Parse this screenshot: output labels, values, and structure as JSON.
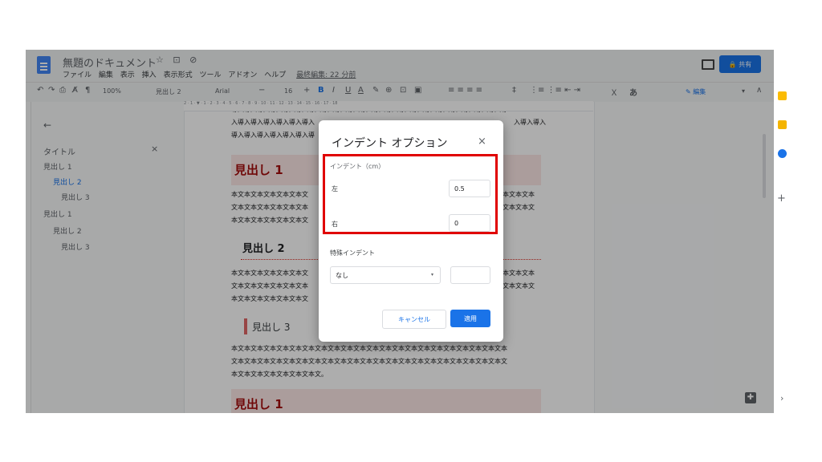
{
  "app": {
    "doc_title": "無題のドキュメント",
    "title_icons": "☆ ⊡ ⊘",
    "menus": [
      "ファイル",
      "編集",
      "表示",
      "挿入",
      "表示形式",
      "ツール",
      "アドオン",
      "ヘルプ"
    ],
    "last_edit": "最終編集: 22 分前",
    "share_label": "🔒 共有"
  },
  "toolbar": {
    "undo": "↶",
    "redo": "↷",
    "print": "⎙",
    "spell": "A̸",
    "paint": "¶",
    "zoom": "100%",
    "style": "見出し 2",
    "font": "Arial",
    "minus": "−",
    "size": "16",
    "plus": "+",
    "bold": "B",
    "italic": "I",
    "underline": "U",
    "text_color": "A",
    "highlight": "✎",
    "link": "⊕",
    "comment": "⊡",
    "image": "▣",
    "align": "≡ ≡ ≡ ≡",
    "spacing": "‡",
    "lists": "⋮≡ ⋮≡ ⇤ ⇥",
    "clear": "Ｘ",
    "ime": "あ",
    "edit_mode": "✎ 編集",
    "caret": "▾",
    "collapse": "∧"
  },
  "ruler": {
    "text": "2 · 1 · ▼ · 1 · 2 · 3 · 4 · 5 · 6 · 7 · 8 · 9 · 10 · 11 · 12 · 13 · 14 · 15 · 16 · 17 · 18"
  },
  "sidebar": {
    "back": "←",
    "close": "×",
    "items": [
      {
        "label": "タイトル"
      },
      {
        "label": "見出し 1"
      },
      {
        "label": "見出し 2"
      },
      {
        "label": "見出し 3"
      },
      {
        "label": "見出し 1"
      },
      {
        "label": "見出し 2"
      },
      {
        "label": "見出し 3"
      }
    ]
  },
  "doc": {
    "title_line1": "導入導入導入導入導入導入導入導入導入導入導入導入導入導入導入導入導入導入導入導入導入導",
    "title_line2": "入導入導入導入導入導入導入",
    "title_line2_right": "入導入導入",
    "title_line3": "導入導入導入導入導入導入導",
    "h1_a": "見出し 1",
    "body1_l1": "本文本文本文本文本文本文",
    "body1_l2": "文本文本文本文本文本文本",
    "body1_l3": "本文本文本文本文本文本文",
    "body1_r1": "本文本文本",
    "body1_r2": "文本文本文",
    "h2": "見出し 2",
    "body2_l1": "本文本文本文本文本文本文",
    "body2_l2": "文本文本文本文本文本文本",
    "body2_l3": "本文本文本文本文本文本文",
    "body2_r1": "本文本文本",
    "body2_r2": "文本文本文",
    "h3": "見出し 3",
    "body3_l1": "本文本文本文本文本文本文本文本文本文本文本文本文本文本文本文本文本文本文本文本文本文本",
    "body3_l2": "文本文本文本文本文本文本文本文本文本文本文本文本文本文本文本文本文本文本文本文本文本文",
    "body3_l3": "本文本文本文本文本文本文本文。",
    "h1_b": "見出し 1"
  },
  "dialog": {
    "title": "インデント オプション",
    "close": "×",
    "section_indent": "インデント（cm）",
    "left_label": "左",
    "left_value": "0.5",
    "right_label": "右",
    "right_value": "0",
    "section_special": "特殊インデント",
    "special_value": "なし",
    "special_caret": "▾",
    "special_amount": "",
    "cancel": "キャンセル",
    "apply": "適用"
  },
  "rightrail": {
    "add": "+",
    "expand": "›",
    "explore": "✚"
  },
  "colors": {
    "accent": "#1a73e8",
    "highlight_box": "#e00000",
    "heading1_bg": "#fce8e6"
  }
}
